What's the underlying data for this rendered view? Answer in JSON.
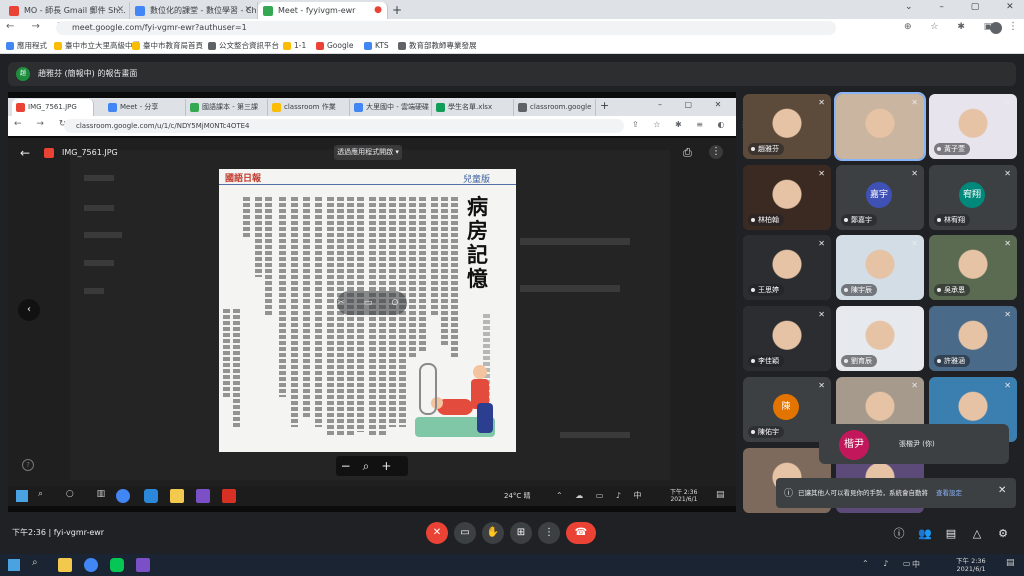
{
  "browser": {
    "tabs": [
      {
        "label": "MO - 師長 Gmail 郵件 Sh...",
        "color": "#ea4335",
        "active": false
      },
      {
        "label": "數位化的課堂 - 數位學習 - Ch",
        "color": "#4285f4",
        "active": false
      },
      {
        "label": "Meet - fyyivgm-ewr",
        "color": "#34a853",
        "active": true
      },
      {
        "label": "新分頁",
        "color": "#fbbc04",
        "active": false
      }
    ],
    "url": "meet.google.com/fyi-vgmr-ewr?authuser=1",
    "bookmarks": [
      {
        "label": "應用程式",
        "color": "#4285f4"
      },
      {
        "label": "臺中市立大里高級中學",
        "color": "#fbbc04"
      },
      {
        "label": "臺中市教育局首頁",
        "color": "#fbbc04"
      },
      {
        "label": "公文整合資訊平台",
        "color": "#5f6368"
      },
      {
        "label": "1-1",
        "color": "#fbbc04"
      },
      {
        "label": "Google",
        "color": "#ea4335"
      },
      {
        "label": "KTS",
        "color": "#4285f4"
      },
      {
        "label": "教育部教師專業發展",
        "color": "#5f6368"
      }
    ]
  },
  "meet": {
    "presenting_banner": "趙雅芬 (簡報中) 的報告畫面",
    "meeting_time": "下午2:36",
    "meeting_code": "fyi-vgmr-ewr",
    "notification": "已讓其他人可以看見你的手勢，系統會自動將其加入畫面",
    "notification_link": "查看設定",
    "raised_name_badge": "楷尹",
    "raised_name": "張楷尹 (你)"
  },
  "shared": {
    "inner_tabs": [
      {
        "label": "IMG_7561.JPG",
        "color": "#ea4335",
        "active": true
      },
      {
        "label": "Meet - 分享",
        "color": "#4285f4",
        "active": false
      },
      {
        "label": "國語課本 - 第三課",
        "color": "#34a853",
        "active": false
      },
      {
        "label": "classroom 作業",
        "color": "#fbbc04",
        "active": false
      },
      {
        "label": "大里國中 - 雲端硬碟",
        "color": "#4285f4",
        "active": false
      },
      {
        "label": "學生名單.xlsx",
        "color": "#0f9d58",
        "active": false
      },
      {
        "label": "classroom.google",
        "color": "#5f6368",
        "active": false
      }
    ],
    "inner_url": "classroom.google.com/u/1/c/NDY5MjM0NTc4OTE4",
    "file_name": "IMG_7561.JPG",
    "open_with": "透過應用程式開啟",
    "newspaper_title": "病房記憶",
    "newspaper_header": "國語日報",
    "newspaper_section": "兒童版",
    "taskbar_time": "下午 2:36",
    "taskbar_date": "2021/6/1",
    "taskbar_weather": "24°C 晴"
  },
  "participants": [
    {
      "name": "趙雅芬",
      "kind": "photo",
      "color": "#5c4a3a"
    },
    {
      "name": "",
      "kind": "photo",
      "color": "#c9b5a0"
    },
    {
      "name": "黃子萱",
      "kind": "photo",
      "color": "#e8e4ee"
    },
    {
      "name": "林柏翰",
      "kind": "photo",
      "color": "#3a2a22"
    },
    {
      "name": "鄭嘉宇",
      "kind": "avatar",
      "initials": "嘉宇",
      "color": "#3f51b5"
    },
    {
      "name": "林宥翔",
      "kind": "avatar",
      "initials": "宥翔",
      "color": "#00897b"
    },
    {
      "name": "王思婷",
      "kind": "photo",
      "color": "#2b2d30"
    },
    {
      "name": "陳宇辰",
      "kind": "photo",
      "color": "#d3dde6"
    },
    {
      "name": "吳承恩",
      "kind": "photo",
      "color": "#5a6b52"
    },
    {
      "name": "李佳穎",
      "kind": "photo",
      "color": "#2b2d30"
    },
    {
      "name": "劉育辰",
      "kind": "photo",
      "color": "#e6e9ee"
    },
    {
      "name": "許雅涵",
      "kind": "photo",
      "color": "#4a6a8a"
    },
    {
      "name": "陳佑宇",
      "kind": "avatar",
      "initials": "陳",
      "color": "#e37400"
    },
    {
      "name": "",
      "kind": "photo",
      "color": "#a59a8c"
    },
    {
      "name": "",
      "kind": "photo",
      "color": "#3b7fb0"
    },
    {
      "name": "",
      "kind": "photo",
      "color": "#7d6a5c"
    },
    {
      "name": "",
      "kind": "photo",
      "color": "#5c4a78"
    }
  ],
  "windows": {
    "time": "下午 2:36",
    "date": "2021/6/1",
    "lang": "中"
  }
}
